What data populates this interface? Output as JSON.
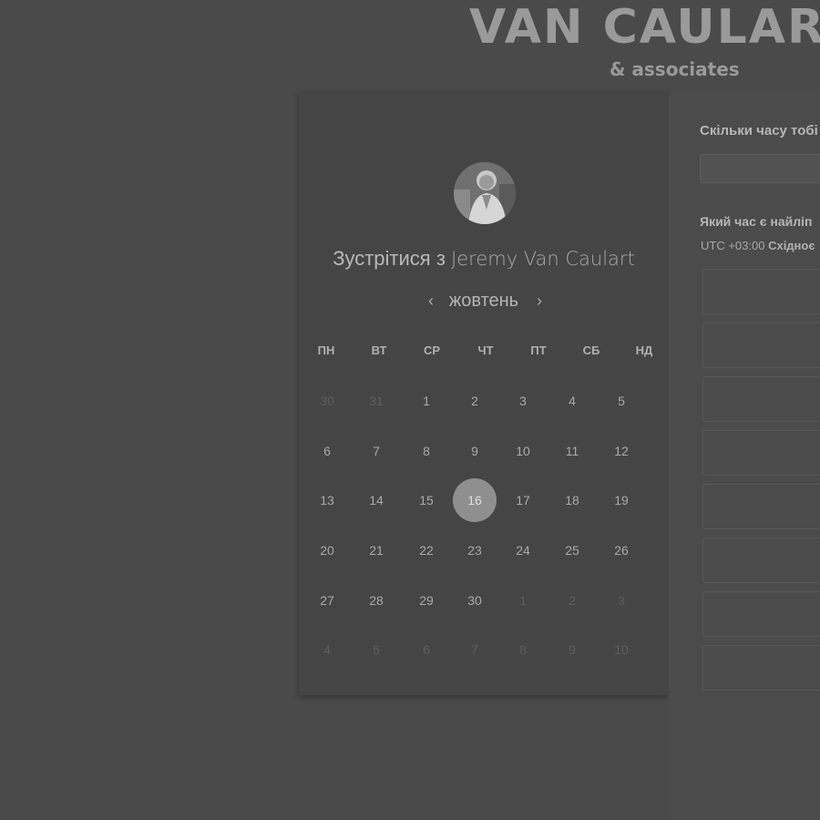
{
  "brand": {
    "name": "VAN CAULAR",
    "tagline": "& associates"
  },
  "calendar": {
    "title_prefix": "Зустрітися з",
    "host_name": "Jeremy Van Caulart",
    "month": "жовтень",
    "prev_icon": "‹",
    "next_icon": "›",
    "weekdays": [
      "ПН",
      "ВТ",
      "СР",
      "ЧТ",
      "ПТ",
      "СБ",
      "НД"
    ],
    "weeks": [
      [
        {
          "d": "30",
          "muted": true
        },
        {
          "d": "31",
          "muted": true
        },
        {
          "d": "1"
        },
        {
          "d": "2"
        },
        {
          "d": "3"
        },
        {
          "d": "4"
        },
        {
          "d": "5"
        }
      ],
      [
        {
          "d": "6"
        },
        {
          "d": "7"
        },
        {
          "d": "8"
        },
        {
          "d": "9"
        },
        {
          "d": "10"
        },
        {
          "d": "11"
        },
        {
          "d": "12"
        }
      ],
      [
        {
          "d": "13"
        },
        {
          "d": "14"
        },
        {
          "d": "15"
        },
        {
          "d": "16",
          "selected": true
        },
        {
          "d": "17"
        },
        {
          "d": "18"
        },
        {
          "d": "19"
        }
      ],
      [
        {
          "d": "20"
        },
        {
          "d": "21"
        },
        {
          "d": "22"
        },
        {
          "d": "23"
        },
        {
          "d": "24"
        },
        {
          "d": "25"
        },
        {
          "d": "26"
        }
      ],
      [
        {
          "d": "27"
        },
        {
          "d": "28"
        },
        {
          "d": "29"
        },
        {
          "d": "30"
        },
        {
          "d": "1",
          "muted": true
        },
        {
          "d": "2",
          "muted": true
        },
        {
          "d": "3",
          "muted": true
        }
      ],
      [
        {
          "d": "4",
          "muted": true
        },
        {
          "d": "5",
          "muted": true
        },
        {
          "d": "6",
          "muted": true
        },
        {
          "d": "7",
          "muted": true
        },
        {
          "d": "8",
          "muted": true
        },
        {
          "d": "9",
          "muted": true
        },
        {
          "d": "10",
          "muted": true
        }
      ]
    ]
  },
  "form": {
    "duration_question": "Скільки часу тобі",
    "duration_value": "",
    "time_question": "Який час є найліп",
    "tz_offset": "UTC +03:00",
    "tz_name": "Східноє",
    "slot_count": 8
  },
  "colors": {
    "background": "#4a4a4a",
    "card": "#454545",
    "selected": "#8f8f8f"
  }
}
